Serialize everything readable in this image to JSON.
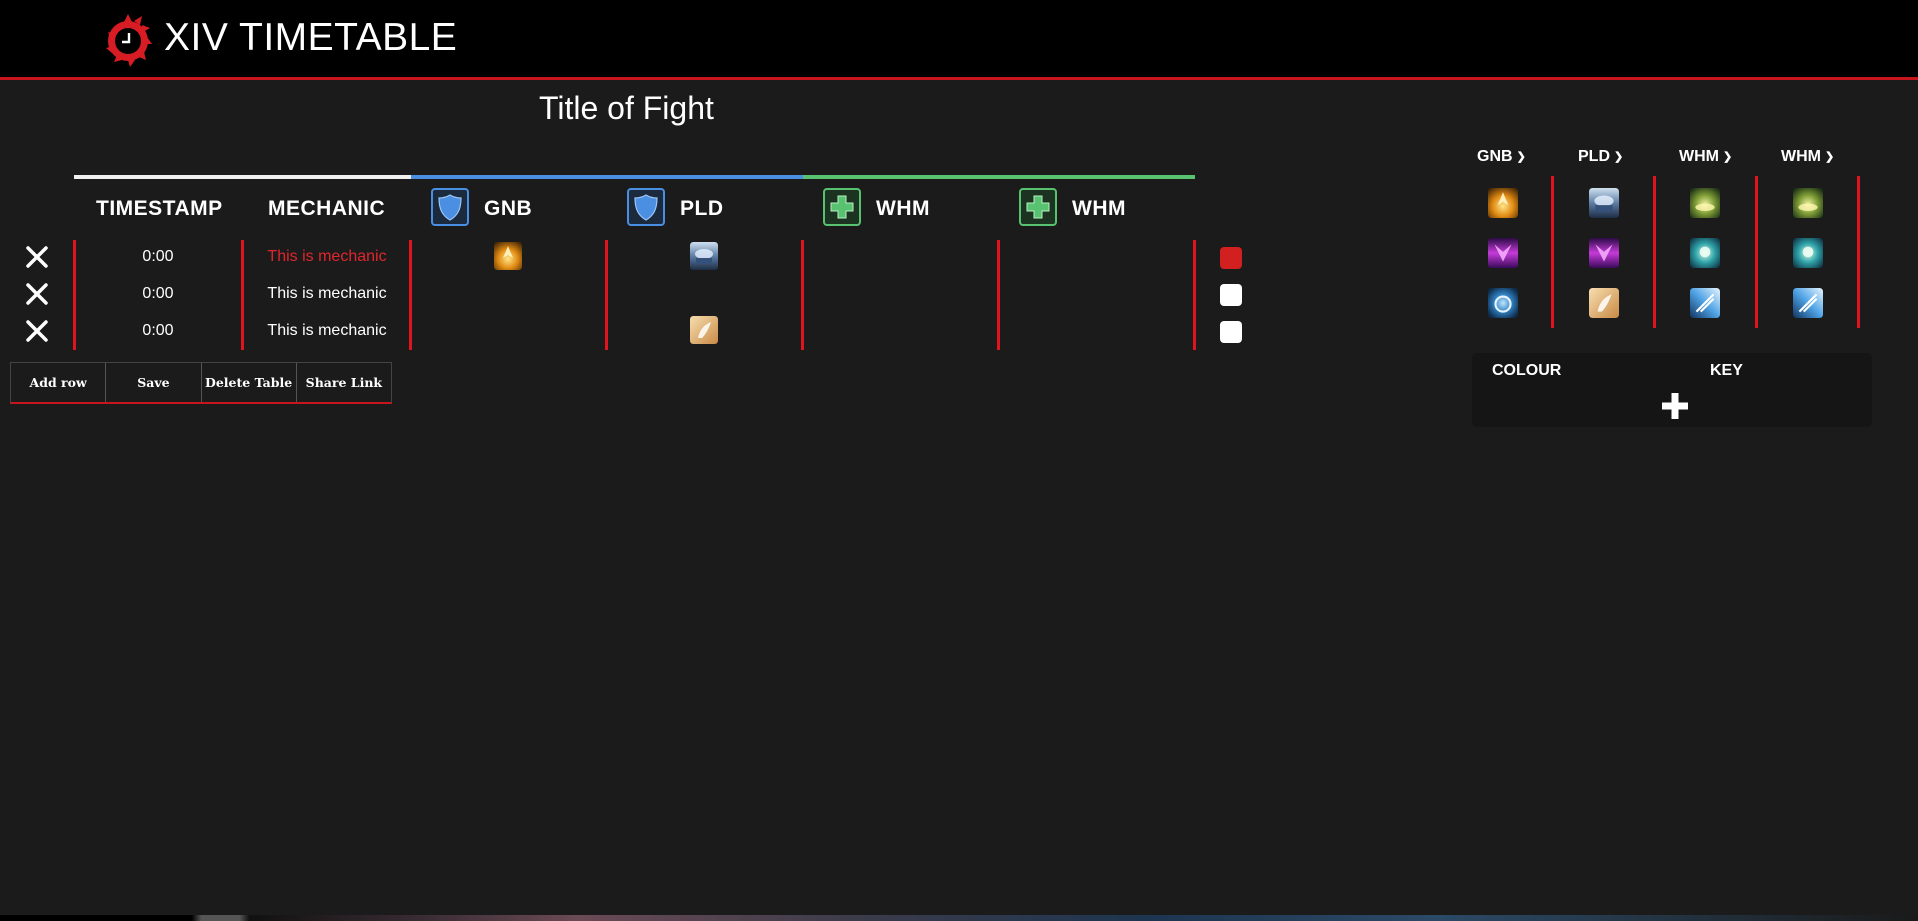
{
  "header": {
    "brand": "XIV TIMETABLE",
    "accent_color": "#c8141c"
  },
  "fight": {
    "title": "Title of Fight"
  },
  "table": {
    "columns": {
      "timestamp": "TIMESTAMP",
      "mechanic": "MECHANIC",
      "jobs": [
        {
          "label": "GNB",
          "role": "tank",
          "icon": "tank-shield-icon"
        },
        {
          "label": "PLD",
          "role": "tank",
          "icon": "tank-shield-icon"
        },
        {
          "label": "WHM",
          "role": "healer",
          "icon": "healer-cross-icon"
        },
        {
          "label": "WHM",
          "role": "healer",
          "icon": "healer-cross-icon"
        }
      ]
    },
    "rows": [
      {
        "timestamp": "0:00",
        "mechanic": "This is mechanic",
        "mechanic_color": "#e0262d",
        "row_color": "#d21f1f",
        "skills": [
          "gnb-skill-icon",
          "pld-skill-icon",
          "",
          ""
        ]
      },
      {
        "timestamp": "0:00",
        "mechanic": "This is mechanic",
        "mechanic_color": "#ffffff",
        "row_color": "#ffffff",
        "skills": [
          "",
          "",
          "",
          ""
        ]
      },
      {
        "timestamp": "0:00",
        "mechanic": "This is mechanic",
        "mechanic_color": "#ffffff",
        "row_color": "#ffffff",
        "skills": [
          "",
          "pld-skill-icon-3",
          "",
          ""
        ]
      }
    ]
  },
  "buttons": {
    "add_row": "Add row",
    "save": "Save",
    "delete_table": "Delete Table",
    "share_link": "Share Link"
  },
  "palette": {
    "jobs": [
      {
        "label": "GNB",
        "skills": [
          "gnb-skill-icon-1",
          "gnb-skill-icon-2",
          "gnb-skill-icon-3"
        ]
      },
      {
        "label": "PLD",
        "skills": [
          "pld-skill-icon-1",
          "pld-skill-icon-2",
          "pld-skill-icon-3"
        ]
      },
      {
        "label": "WHM",
        "skills": [
          "whm-skill-icon-1",
          "whm-skill-icon-2",
          "whm-skill-icon-3"
        ]
      },
      {
        "label": "WHM",
        "skills": [
          "whm-skill-icon-1",
          "whm-skill-icon-2",
          "whm-skill-icon-3"
        ]
      }
    ]
  },
  "legend": {
    "colour_label": "COLOUR",
    "key_label": "KEY",
    "add_icon": "plus-icon"
  },
  "colors": {
    "tank": "#4b8fe2",
    "healer": "#59c270",
    "neutral": "#f0f0f0",
    "divider": "#e0141f"
  }
}
